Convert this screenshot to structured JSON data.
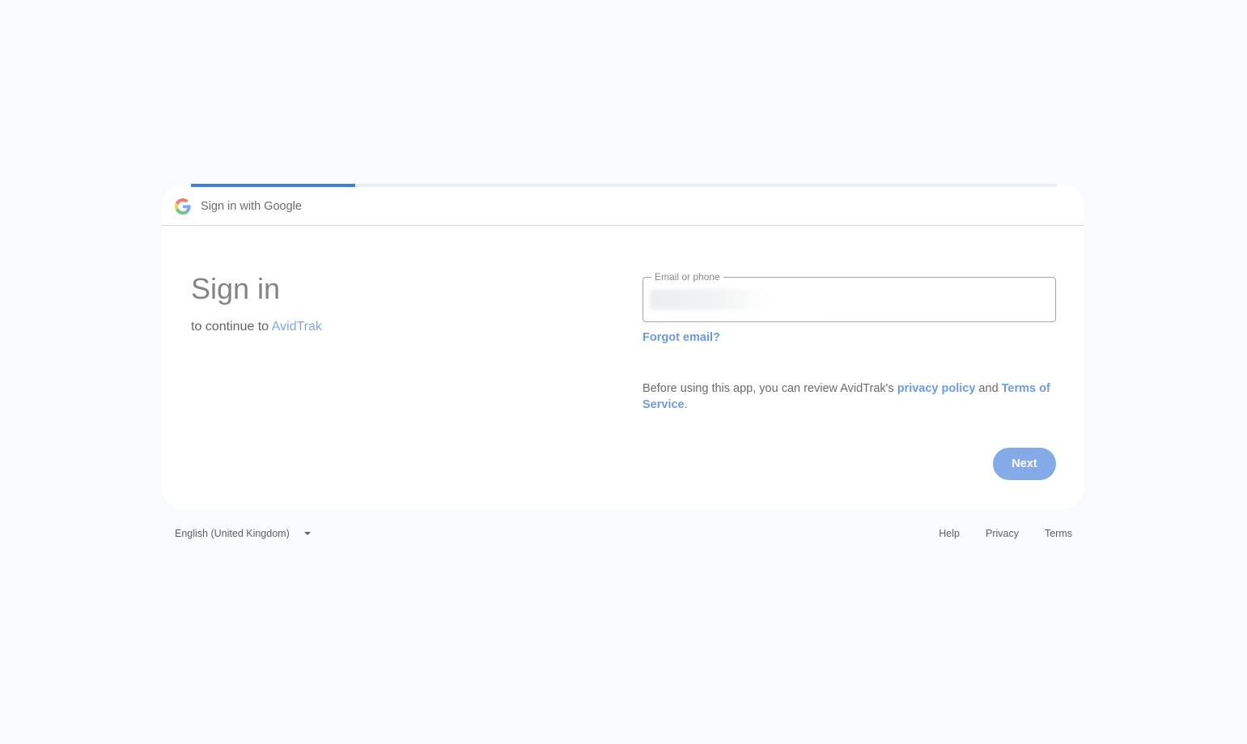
{
  "header": {
    "title": "Sign in with Google",
    "logo_icon": "google-g-icon"
  },
  "progress": {
    "value": 0.19
  },
  "main": {
    "title": "Sign in",
    "subtitle_prefix": "to continue to ",
    "app_name": "AvidTrak"
  },
  "form": {
    "email_label": "Email or phone",
    "email_value": "",
    "forgot_email": "Forgot email?",
    "policy_prefix": "Before using this app, you can review AvidTrak's ",
    "privacy_policy": "privacy policy",
    "policy_and": " and ",
    "terms_of_service": "Terms of Service",
    "policy_suffix": ".",
    "next_label": "Next"
  },
  "footer": {
    "language": "English (United Kingdom)",
    "links": [
      "Help",
      "Privacy",
      "Terms"
    ]
  },
  "colors": {
    "background": "#f8fafd",
    "accent": "#0b57d0",
    "card": "#ffffff"
  }
}
